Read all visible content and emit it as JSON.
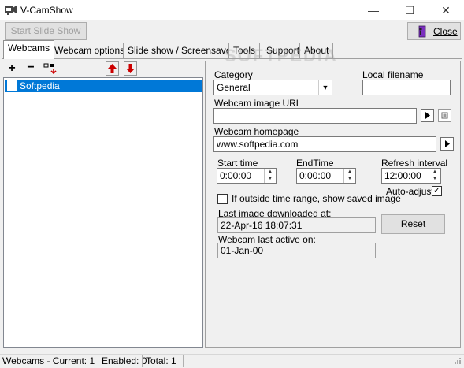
{
  "window": {
    "title": "V-CamShow"
  },
  "toolbar": {
    "start_slide_show": "Start Slide Show",
    "close": "Close"
  },
  "tabs": [
    "Webcams",
    "Webcam options",
    "Slide show / Screensaver",
    "Tools",
    "Support",
    "About"
  ],
  "webcams": {
    "items": [
      {
        "label": "Softpedia",
        "checked": false
      }
    ]
  },
  "form": {
    "category_label": "Category",
    "category_value": "General",
    "local_filename_label": "Local filename",
    "local_filename_value": "",
    "image_url_label": "Webcam image URL",
    "image_url_value": "",
    "homepage_label": "Webcam homepage",
    "homepage_value": "www.softpedia.com",
    "start_time_label": "Start time",
    "start_time_value": "0:00:00",
    "end_time_label": "EndTime",
    "end_time_value": "0:00:00",
    "refresh_label": "Refresh interval",
    "refresh_value": "12:00:00",
    "auto_adjust_label": "Auto-adjust",
    "outside_range_label": "If outside time range, show saved image",
    "last_download_label": "Last image downloaded at:",
    "last_download_value": "22-Apr-16 18:07:31",
    "reset_label": "Reset",
    "last_active_label": "Webcam last active on:",
    "last_active_value": "01-Jan-00"
  },
  "status": {
    "section1": "Webcams - Current: 1",
    "section2": "Enabled: 0",
    "section3": "Total: 1"
  },
  "watermark": "SOFTPEDIA",
  "colors": {
    "selection": "#0078d7",
    "arrow_red": "#cc0000"
  }
}
